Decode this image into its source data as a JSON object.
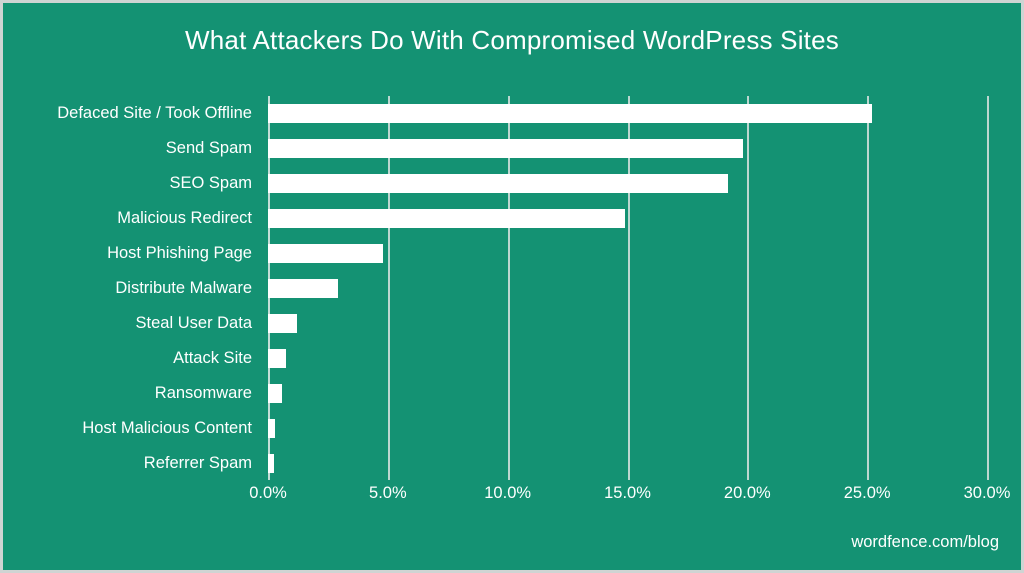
{
  "theme": {
    "background": "#149273",
    "bar_color": "#ffffff",
    "gridline_color": "#d9e3e0",
    "text_color": "#ffffff",
    "border_color": "#cfd4d3"
  },
  "footer": {
    "source_label": "wordfence.com/blog"
  },
  "chart_data": {
    "type": "bar",
    "orientation": "horizontal",
    "title": "What Attackers Do With Compromised WordPress Sites",
    "xlabel": "",
    "ylabel": "",
    "xlim": [
      0,
      30
    ],
    "xticks": [
      0,
      5,
      10,
      15,
      20,
      25,
      30
    ],
    "xtick_labels": [
      "0.0%",
      "5.0%",
      "10.0%",
      "15.0%",
      "20.0%",
      "25.0%",
      "30.0%"
    ],
    "grid": true,
    "legend": null,
    "value_unit": "percent",
    "categories": [
      "Defaced Site / Took Offline",
      "Send Spam",
      "SEO Spam",
      "Malicious Redirect",
      "Host Phishing Page",
      "Distribute Malware",
      "Steal User Data",
      "Attack Site",
      "Ransomware",
      "Host Malicious Content",
      "Referrer Spam"
    ],
    "values": [
      25.2,
      19.8,
      19.2,
      14.9,
      4.8,
      2.9,
      1.2,
      0.75,
      0.6,
      0.3,
      0.25
    ]
  }
}
